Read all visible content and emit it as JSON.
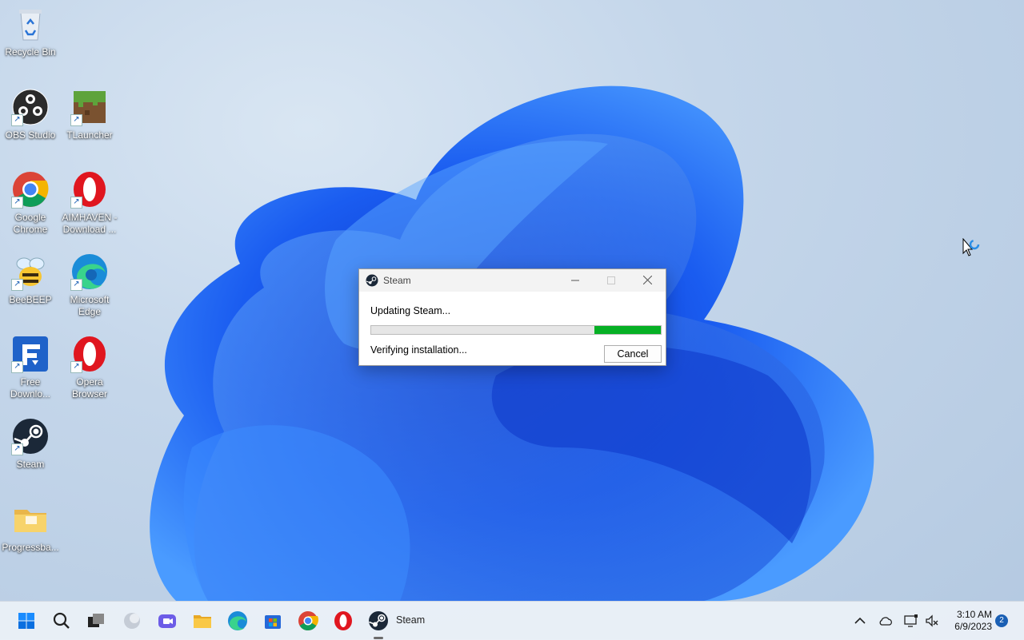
{
  "desktop": {
    "icons": [
      {
        "label": "Recycle Bin",
        "icon": "recycle-bin-icon"
      },
      {
        "label": "OBS Studio",
        "icon": "obs-studio-icon"
      },
      {
        "label": "TLauncher",
        "icon": "tlauncher-icon"
      },
      {
        "label": "Google Chrome",
        "icon": "chrome-icon"
      },
      {
        "label": "AIMHAVEN - Download ...",
        "icon": "opera-icon"
      },
      {
        "label": "BeeBEEP",
        "icon": "beebeep-icon"
      },
      {
        "label": "Microsoft Edge",
        "icon": "edge-icon"
      },
      {
        "label": "Free Downlo...",
        "icon": "free-download-manager-icon"
      },
      {
        "label": "Opera Browser",
        "icon": "opera-icon"
      },
      {
        "label": "Steam",
        "icon": "steam-icon"
      },
      {
        "label": "Progressba...",
        "icon": "folder-icon"
      }
    ]
  },
  "dialog": {
    "title": "Steam",
    "status": "Updating Steam...",
    "substatus": "Verifying installation...",
    "cancel_label": "Cancel",
    "progress": 0.23,
    "progress_color": "#06b025"
  },
  "taskbar": {
    "apps": [
      "start",
      "search",
      "task-view",
      "widgets",
      "teams-chat",
      "file-explorer",
      "edge",
      "microsoft-store",
      "chrome",
      "opera",
      "steam"
    ],
    "active_app_label": "Steam",
    "tray": [
      "chevron-up-icon",
      "onedrive-cloud-icon",
      "display-icon",
      "network-speaker-icon"
    ],
    "time": "3:10 AM",
    "date": "6/9/2023",
    "notification_count": "2"
  },
  "colors": {
    "accent": "#1a5fb4",
    "wallpaper_blue": "#1f6bff"
  }
}
